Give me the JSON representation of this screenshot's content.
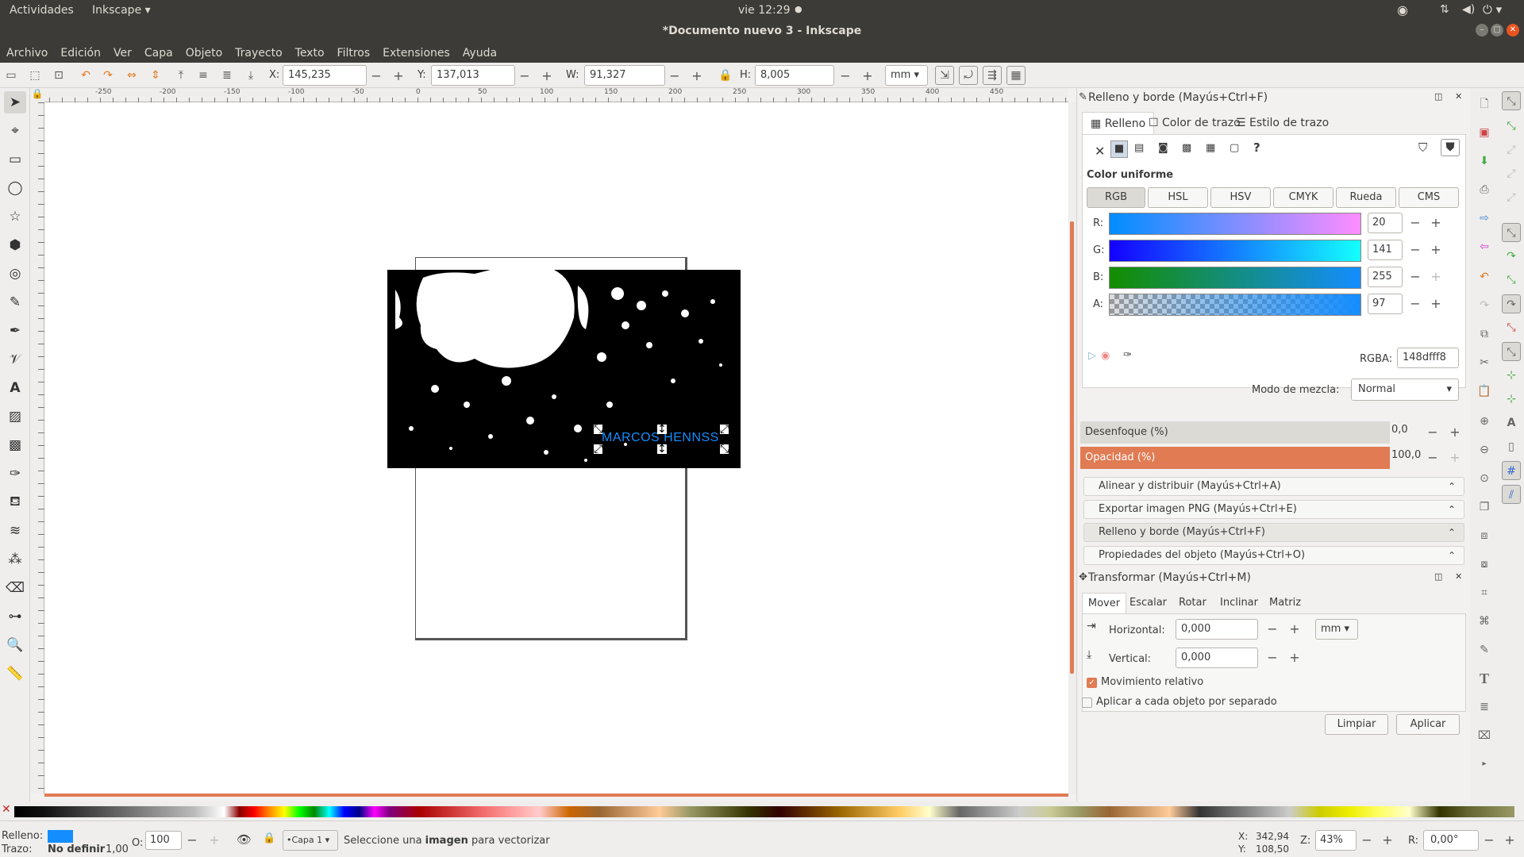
{
  "topbar": {
    "activities": "Actividades",
    "app": "Inkscape",
    "clock": "vie 12:29"
  },
  "window": {
    "title": "*Documento nuevo 3 - Inkscape"
  },
  "menu": [
    "Archivo",
    "Edición",
    "Ver",
    "Capa",
    "Objeto",
    "Trayecto",
    "Texto",
    "Filtros",
    "Extensiones",
    "Ayuda"
  ],
  "controls": {
    "x_label": "X:",
    "x": "145,235",
    "y_label": "Y:",
    "y": "137,013",
    "w_label": "W:",
    "w": "91,327",
    "h_label": "H:",
    "h": "8,005",
    "unit": "mm"
  },
  "ruler": {
    "ticks": [
      "-250",
      "-200",
      "-150",
      "-100",
      "-50",
      "0",
      "50",
      "100",
      "150",
      "200",
      "250",
      "300",
      "350",
      "400",
      "450"
    ]
  },
  "canvas": {
    "selected_text": "MARCOS HENNSS"
  },
  "fill_stroke": {
    "title": "Relleno y borde (Mayús+Ctrl+F)",
    "tabs": [
      "Relleno",
      "Color de trazo",
      "Estilo de trazo"
    ],
    "section": "Color uniforme",
    "modes": [
      "RGB",
      "HSL",
      "HSV",
      "CMYK",
      "Rueda",
      "CMS"
    ],
    "channels": [
      {
        "label": "R:",
        "value": "20"
      },
      {
        "label": "G:",
        "value": "141"
      },
      {
        "label": "B:",
        "value": "255"
      },
      {
        "label": "A:",
        "value": "97"
      }
    ],
    "rgba_label": "RGBA:",
    "rgba": "148dfff8",
    "blend_label": "Modo de mezcla:",
    "blend": "Normal",
    "blur_label": "Desenfoque (%)",
    "blur": "0,0",
    "opacity_label": "Opacidad (%)",
    "opacity": "100,0"
  },
  "docks": [
    "Alinear y distribuir (Mayús+Ctrl+A)",
    "Exportar imagen PNG (Mayús+Ctrl+E)",
    "Relleno y borde (Mayús+Ctrl+F)",
    "Propiedades del objeto (Mayús+Ctrl+O)"
  ],
  "transform": {
    "title": "Transformar (Mayús+Ctrl+M)",
    "tabs": [
      "Mover",
      "Escalar",
      "Rotar",
      "Inclinar",
      "Matriz"
    ],
    "h_label": "Horizontal:",
    "h": "0,000",
    "v_label": "Vertical:",
    "v": "0,000",
    "unit": "mm",
    "relative": "Movimiento relativo",
    "each": "Aplicar a cada objeto por separado",
    "clear": "Limpiar",
    "apply": "Aplicar"
  },
  "status": {
    "fill_label": "Relleno:",
    "stroke_label": "Trazo:",
    "stroke_value": "No definir",
    "stroke_width": "1,00",
    "o_label": "O:",
    "o_value": "100",
    "layer": "•Capa 1",
    "message_pre": "Seleccione una ",
    "message_bold": "imagen",
    "message_post": " para vectorizar",
    "x_label": "X:",
    "x": "342,94",
    "y_label": "Y:",
    "y": "108,50",
    "z_label": "Z:",
    "zoom": "43%",
    "r_label": "R:",
    "rotation": "0,00°"
  },
  "colors": {
    "accent": "#148dff",
    "orange": "#e07b53",
    "dark": "#3c3b37"
  }
}
